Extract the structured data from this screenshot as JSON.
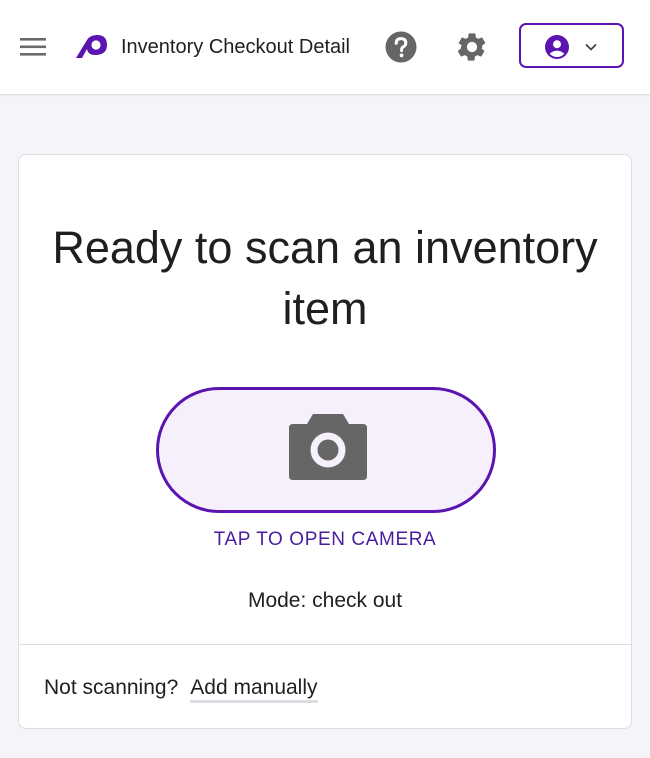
{
  "header": {
    "title": "Inventory Checkout Detail",
    "menu_icon": "hamburger-menu-icon",
    "logo_icon": "app-logo-icon",
    "help_icon": "help-circle-icon",
    "settings_icon": "gear-icon",
    "account_icon": "user-avatar-icon",
    "account_chevron_icon": "chevron-down-icon"
  },
  "scan_card": {
    "headline": "Ready to scan an inventory item",
    "camera_icon": "camera-icon",
    "camera_label": "TAP TO OPEN CAMERA",
    "mode_text": "Mode: check out",
    "footer": {
      "prompt": "Not scanning?",
      "link": "Add manually"
    }
  },
  "colors": {
    "accent": "#5b14b0",
    "accent_text": "#4a1da0",
    "camera_button_fill": "#f6f0fc",
    "icon_gray": "#666666",
    "page_background": "#f4f4f9",
    "card_background": "#ffffff",
    "border": "#dcdce2"
  }
}
